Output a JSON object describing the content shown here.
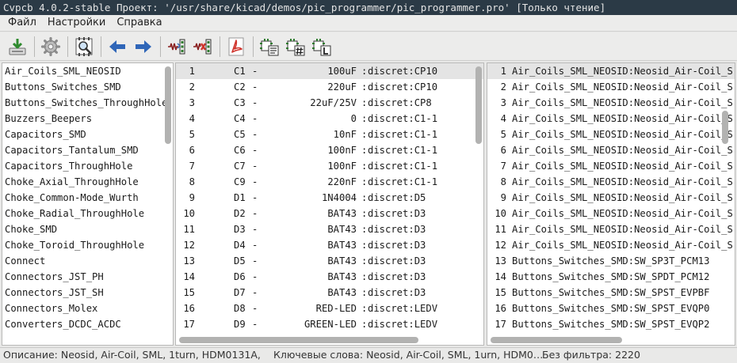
{
  "window": {
    "title": "Cvpcb 4.0.2-stable  Проект: '/usr/share/kicad/demos/pic_programmer/pic_programmer.pro' [Только чтение]"
  },
  "menu": {
    "items": [
      {
        "label": "Файл"
      },
      {
        "label": "Настройки"
      },
      {
        "label": "Справка"
      }
    ]
  },
  "toolbar": {
    "buttons": [
      {
        "icon": "save-icon"
      },
      {
        "icon": "gear-icon"
      },
      {
        "icon": "footprint-viewer-icon"
      },
      {
        "icon": "arrow-left-icon"
      },
      {
        "icon": "arrow-right-icon"
      },
      {
        "icon": "auto-associate-icon"
      },
      {
        "icon": "delete-association-icon"
      },
      {
        "icon": "pdf-icon"
      },
      {
        "icon": "filter-by-keywords-icon"
      },
      {
        "icon": "filter-by-pin-count-icon"
      },
      {
        "icon": "filter-by-library-icon"
      }
    ]
  },
  "libraries": {
    "items": [
      "Air_Coils_SML_NEOSID",
      "Buttons_Switches_SMD",
      "Buttons_Switches_ThroughHole",
      "Buzzers_Beepers",
      "Capacitors_SMD",
      "Capacitors_Tantalum_SMD",
      "Capacitors_ThroughHole",
      "Choke_Axial_ThroughHole",
      "Choke_Common-Mode_Wurth",
      "Choke_Radial_ThroughHole",
      "Choke_SMD",
      "Choke_Toroid_ThroughHole",
      "Connect",
      "Connectors_JST_PH",
      "Connectors_JST_SH",
      "Connectors_Molex",
      "Converters_DCDC_ACDC"
    ]
  },
  "components": {
    "rows": [
      {
        "num": "1",
        "ref": "C1",
        "dash": "-",
        "value": "100uF",
        "colon": ":",
        "footprint": "discret:CP10"
      },
      {
        "num": "2",
        "ref": "C2",
        "dash": "-",
        "value": "220uF",
        "colon": ":",
        "footprint": "discret:CP10"
      },
      {
        "num": "3",
        "ref": "C3",
        "dash": "-",
        "value": "22uF/25V",
        "colon": ":",
        "footprint": "discret:CP8"
      },
      {
        "num": "4",
        "ref": "C4",
        "dash": "-",
        "value": "0",
        "colon": ":",
        "footprint": "discret:C1-1"
      },
      {
        "num": "5",
        "ref": "C5",
        "dash": "-",
        "value": "10nF",
        "colon": ":",
        "footprint": "discret:C1-1"
      },
      {
        "num": "6",
        "ref": "C6",
        "dash": "-",
        "value": "100nF",
        "colon": ":",
        "footprint": "discret:C1-1"
      },
      {
        "num": "7",
        "ref": "C7",
        "dash": "-",
        "value": "100nF",
        "colon": ":",
        "footprint": "discret:C1-1"
      },
      {
        "num": "8",
        "ref": "C9",
        "dash": "-",
        "value": "220nF",
        "colon": ":",
        "footprint": "discret:C1-1"
      },
      {
        "num": "9",
        "ref": "D1",
        "dash": "-",
        "value": "1N4004",
        "colon": ":",
        "footprint": "discret:D5"
      },
      {
        "num": "10",
        "ref": "D2",
        "dash": "-",
        "value": "BAT43",
        "colon": ":",
        "footprint": "discret:D3"
      },
      {
        "num": "11",
        "ref": "D3",
        "dash": "-",
        "value": "BAT43",
        "colon": ":",
        "footprint": "discret:D3"
      },
      {
        "num": "12",
        "ref": "D4",
        "dash": "-",
        "value": "BAT43",
        "colon": ":",
        "footprint": "discret:D3"
      },
      {
        "num": "13",
        "ref": "D5",
        "dash": "-",
        "value": "BAT43",
        "colon": ":",
        "footprint": "discret:D3"
      },
      {
        "num": "14",
        "ref": "D6",
        "dash": "-",
        "value": "BAT43",
        "colon": ":",
        "footprint": "discret:D3"
      },
      {
        "num": "15",
        "ref": "D7",
        "dash": "-",
        "value": "BAT43",
        "colon": ":",
        "footprint": "discret:D3"
      },
      {
        "num": "16",
        "ref": "D8",
        "dash": "-",
        "value": "RED-LED",
        "colon": ":",
        "footprint": "discret:LEDV"
      },
      {
        "num": "17",
        "ref": "D9",
        "dash": "-",
        "value": "GREEN-LED",
        "colon": ":",
        "footprint": "discret:LEDV"
      }
    ]
  },
  "footprints": {
    "rows": [
      {
        "num": "1",
        "name": "Air_Coils_SML_NEOSID:Neosid_Air-Coil_S"
      },
      {
        "num": "2",
        "name": "Air_Coils_SML_NEOSID:Neosid_Air-Coil_S"
      },
      {
        "num": "3",
        "name": "Air_Coils_SML_NEOSID:Neosid_Air-Coil_S"
      },
      {
        "num": "4",
        "name": "Air_Coils_SML_NEOSID:Neosid_Air-Coil_S"
      },
      {
        "num": "5",
        "name": "Air_Coils_SML_NEOSID:Neosid_Air-Coil_S"
      },
      {
        "num": "6",
        "name": "Air_Coils_SML_NEOSID:Neosid_Air-Coil_S"
      },
      {
        "num": "7",
        "name": "Air_Coils_SML_NEOSID:Neosid_Air-Coil_S"
      },
      {
        "num": "8",
        "name": "Air_Coils_SML_NEOSID:Neosid_Air-Coil_S"
      },
      {
        "num": "9",
        "name": "Air_Coils_SML_NEOSID:Neosid_Air-Coil_S"
      },
      {
        "num": "10",
        "name": "Air_Coils_SML_NEOSID:Neosid_Air-Coil_S"
      },
      {
        "num": "11",
        "name": "Air_Coils_SML_NEOSID:Neosid_Air-Coil_S"
      },
      {
        "num": "12",
        "name": "Air_Coils_SML_NEOSID:Neosid_Air-Coil_S"
      },
      {
        "num": "13",
        "name": "Buttons_Switches_SMD:SW_SP3T_PCM13"
      },
      {
        "num": "14",
        "name": "Buttons_Switches_SMD:SW_SPDT_PCM12"
      },
      {
        "num": "15",
        "name": "Buttons_Switches_SMD:SW_SPST_EVPBF"
      },
      {
        "num": "16",
        "name": "Buttons_Switches_SMD:SW_SPST_EVQP0"
      },
      {
        "num": "17",
        "name": "Buttons_Switches_SMD:SW_SPST_EVQP2"
      }
    ]
  },
  "status": {
    "description": "Описание: Neosid, Air-Coil, SML, 1turn, HDM0131A,",
    "keywords": "Ключевые слова: Neosid, Air-Coil, SML, 1urn, HDM0…",
    "filter": "Без фильтра: 2220"
  },
  "colors": {
    "titlebar": "#2b3a46",
    "selection": "#e4e4e4",
    "arrow_blue": "#2f66b8",
    "pdf_red": "#d0342c"
  }
}
